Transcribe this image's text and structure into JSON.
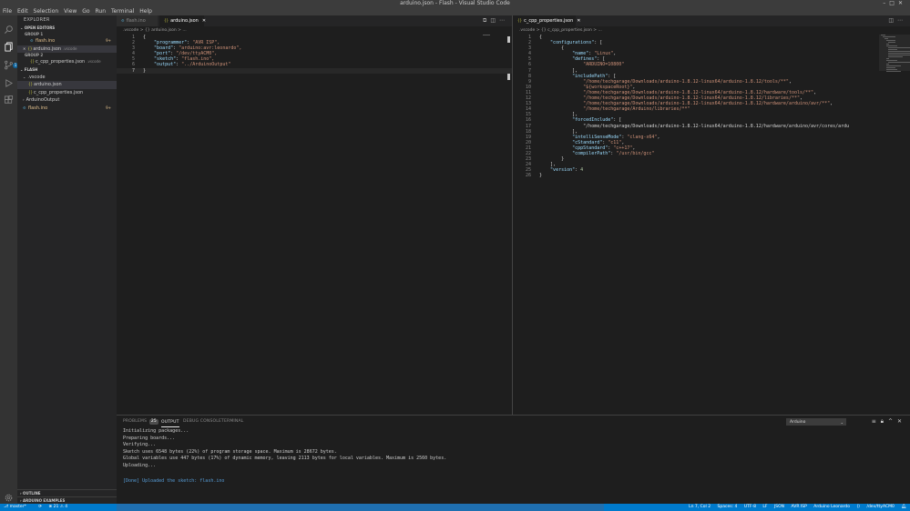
{
  "window": {
    "title": "arduino.json - Flash - Visual Studio Code"
  },
  "menu": [
    "File",
    "Edit",
    "Selection",
    "View",
    "Go",
    "Run",
    "Terminal",
    "Help"
  ],
  "sidebar": {
    "header": "EXPLORER",
    "open_editors": {
      "title": "OPEN EDITORS",
      "group1": {
        "title": "GROUP 1",
        "items": [
          {
            "name": "flash.ino",
            "mod": "9+"
          }
        ]
      },
      "group2": {
        "title": "GROUP 2",
        "items": [
          {
            "name": "c_cpp_properties.json",
            "desc": ".vscode"
          }
        ]
      },
      "active_item": {
        "name": "arduino.json",
        "desc": ".vscode"
      }
    },
    "folder": {
      "title": "FLASH",
      "items": [
        {
          "name": ".vscode"
        },
        {
          "name": "arduino.json"
        },
        {
          "name": "c_cpp_properties.json"
        },
        {
          "name": "ArduinoOutput"
        },
        {
          "name": "flash.ino",
          "mod": "9+"
        }
      ]
    },
    "bottom": [
      "OUTLINE",
      "ARDUINO EXAMPLES"
    ]
  },
  "left_editor": {
    "tabs": [
      {
        "label": "flash.ino"
      },
      {
        "label": "arduino.json"
      }
    ],
    "breadcrumb": ".vscode > {} arduino.json > ...",
    "lines": [
      {
        "n": "1",
        "text": "{"
      },
      {
        "n": "2",
        "k": "\"programmer\"",
        "v": "\"AVR ISP\","
      },
      {
        "n": "3",
        "k": "\"board\"",
        "v": "\"arduino:avr:leonardo\","
      },
      {
        "n": "4",
        "k": "\"port\"",
        "v": "\"/dev/ttyACM0\","
      },
      {
        "n": "5",
        "k": "\"sketch\"",
        "v": "\"flash.ino\","
      },
      {
        "n": "6",
        "k": "\"output\"",
        "v": "\"../ArduinoOutput\""
      },
      {
        "n": "7",
        "text": "}"
      }
    ]
  },
  "right_editor": {
    "tabs": [
      {
        "label": "c_cpp_properties.json"
      }
    ],
    "breadcrumb": ".vscode > {} c_cpp_properties.json > ...",
    "lines": [
      {
        "n": "1",
        "text": "{"
      },
      {
        "n": "2",
        "text": "    \"configurations\": ["
      },
      {
        "n": "3",
        "text": "        {"
      },
      {
        "n": "4",
        "text": "            \"name\": \"Linux\","
      },
      {
        "n": "5",
        "text": "            \"defines\": ["
      },
      {
        "n": "6",
        "text": "                \"ARDUINO=10800\""
      },
      {
        "n": "7",
        "text": "            ],"
      },
      {
        "n": "8",
        "text": "            \"includePath\": ["
      },
      {
        "n": "9",
        "text": "                \"/home/techgarage/Downloads/arduino-1.8.12-linux64/arduino-1.8.12/tools/**\","
      },
      {
        "n": "10",
        "text": "                \"${workspaceRoot}\","
      },
      {
        "n": "11",
        "text": "                \"/home/techgarage/Downloads/arduino-1.8.12-linux64/arduino-1.8.12/hardware/tools/**\","
      },
      {
        "n": "12",
        "text": "                \"/home/techgarage/Downloads/arduino-1.8.12-linux64/arduino-1.8.12/libraries/**\","
      },
      {
        "n": "13",
        "text": "                \"/home/techgarage/Downloads/arduino-1.8.12-linux64/arduino-1.8.12/hardware/arduino/avr/**\","
      },
      {
        "n": "14",
        "text": "                \"/home/techgarage/Arduino/libraries/**\""
      },
      {
        "n": "15",
        "text": "            ],"
      },
      {
        "n": "16",
        "text": "            \"forcedInclude\": ["
      },
      {
        "n": "17",
        "text": "                \"/home/techgarage/Downloads/arduino-1.8.12-linux64/arduino-1.8.12/hardware/arduino/avr/cores/ardu"
      },
      {
        "n": "18",
        "text": "            ],"
      },
      {
        "n": "19",
        "text": "            \"intelliSenseMode\": \"clang-x64\","
      },
      {
        "n": "20",
        "text": "            \"cStandard\": \"c11\","
      },
      {
        "n": "21",
        "text": "            \"cppStandard\": \"c++17\","
      },
      {
        "n": "22",
        "text": "            \"compilerPath\": \"/usr/bin/gcc\""
      },
      {
        "n": "23",
        "text": "        }"
      },
      {
        "n": "24",
        "text": "    ],"
      },
      {
        "n": "25",
        "text": "    \"version\": 4"
      },
      {
        "n": "26",
        "text": "}"
      }
    ]
  },
  "panel": {
    "tabs": [
      "PROBLEMS",
      "OUTPUT",
      "DEBUG CONSOLE",
      "TERMINAL"
    ],
    "problems_count": "25",
    "output_source": "Arduino",
    "output_lines": [
      "Initializing packages...",
      "Preparing boards...",
      "Verifying...",
      "Sketch uses 6548 bytes (22%) of program storage space. Maximum is 28672 bytes.",
      "Global variables use 447 bytes (17%) of dynamic memory, leaving 2113 bytes for local variables. Maximum is 2560 bytes.",
      "Uploading..."
    ],
    "done_line": "[Done] Uploaded the sketch: flash.ino"
  },
  "statusbar": {
    "branch": "master*",
    "sync": "⟳",
    "problems": "⊗ 21 ⚠ 4",
    "right": [
      "Ln 7, Col 2",
      "Spaces: 4",
      "UTF-8",
      "LF",
      "JSON",
      "AVR ISP",
      "Arduino Leonardo",
      "⟨⟩",
      "/dev/ttyACM0"
    ]
  }
}
